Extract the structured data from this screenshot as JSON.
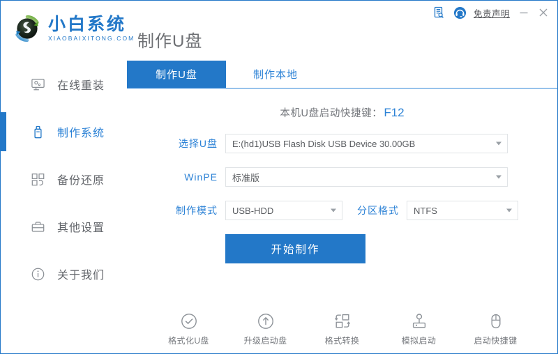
{
  "window": {
    "title": "小白系统",
    "border_color": "#2378c8"
  },
  "titlebar": {
    "doc_icon": "document-search-icon",
    "support_icon": "headset-support-icon",
    "disclaimer_label": "免责声明",
    "minimize_label": "minimize-icon",
    "close_label": "close-icon"
  },
  "brand": {
    "logo_icon": "xiaobai-logo-icon",
    "name": "小白系统",
    "domain": "XIAOBAIXITONG.COM",
    "color": "#2378c8"
  },
  "page": {
    "title": "制作U盘"
  },
  "sidebar": {
    "items": [
      {
        "label": "在线重装",
        "icon": "monitor-icon",
        "active": false
      },
      {
        "label": "制作系统",
        "icon": "usb-drive-icon",
        "active": true
      },
      {
        "label": "备份还原",
        "icon": "grid-restore-icon",
        "active": false
      },
      {
        "label": "其他设置",
        "icon": "toolbox-icon",
        "active": false
      },
      {
        "label": "关于我们",
        "icon": "info-circle-icon",
        "active": false
      }
    ],
    "active_index": 1,
    "active_color": "#2c82d6"
  },
  "tabs": [
    {
      "label": "制作U盘",
      "active": true
    },
    {
      "label": "制作本地",
      "active": false
    }
  ],
  "shortcut": {
    "text": "本机U盘启动快捷键：",
    "key": "F12",
    "key_color": "#2c82d6"
  },
  "form": {
    "usb": {
      "label": "选择U盘",
      "value": "E:(hd1)USB Flash Disk USB Device 30.00GB",
      "options": [
        "E:(hd1)USB Flash Disk USB Device 30.00GB"
      ]
    },
    "winpe": {
      "label": "WinPE",
      "value": "标准版",
      "options": [
        "标准版"
      ]
    },
    "mode": {
      "label": "制作模式",
      "value": "USB-HDD",
      "options": [
        "USB-HDD"
      ]
    },
    "partition": {
      "label": "分区格式",
      "value": "NTFS",
      "options": [
        "NTFS"
      ]
    }
  },
  "actions": {
    "start_label": "开始制作",
    "start_color": "#2378c8"
  },
  "bottom_toolbar": [
    {
      "label": "格式化U盘",
      "icon": "check-circle-icon"
    },
    {
      "label": "升级启动盘",
      "icon": "arrow-up-circle-icon"
    },
    {
      "label": "格式转换",
      "icon": "convert-squares-icon"
    },
    {
      "label": "模拟启动",
      "icon": "joystick-icon"
    },
    {
      "label": "启动快捷键",
      "icon": "mouse-icon"
    }
  ]
}
